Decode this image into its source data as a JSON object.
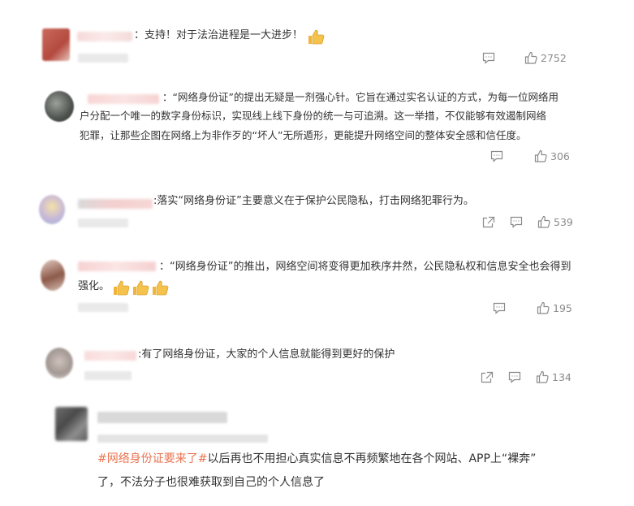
{
  "comments": [
    {
      "text": "：支持！对于法治进程是一大进步！",
      "likes": "2752"
    },
    {
      "text": "：“网络身份证”的提出无疑是一剂强心针。它旨在通过实名认证的方式，为每一位网络用户分配一个唯一的数字身份标识，实现线上线下身份的统一与可追溯。这一举措，不仅能够有效遏制网络犯罪，让那些企图在网络上为非作歹的“坏人”无所遁形，更能提升网络空间的整体安全感和信任度。",
      "line1": "：“网络身份证”的提出无疑是一剂强心针。它旨在通过实名认证的方式，为每一位网络用",
      "line2": "户分配一个唯一的数字身份标识，实现线上线下身份的统一与可追溯。这一举措，不仅能够有效遏制网络",
      "line3": "犯罪，让那些企图在网络上为非作歹的“坏人”无所遁形，更能提升网络空间的整体安全感和信任度。",
      "likes": "306"
    },
    {
      "text": ":落实“网络身份证”主要意义在于保护公民隐私，打击网络犯罪行为。",
      "likes": "539"
    },
    {
      "line1": "：“网络身份证”的推出，网络空间将变得更加秩序井然，公民隐私权和信息安全也会得到",
      "line2": "强化。",
      "likes": "195"
    },
    {
      "text": ":有了网络身份证，大家的个人信息就能得到更好的保护",
      "likes": "134"
    },
    {
      "topic": "#网络身份证要来了#",
      "line1_rest": "以后再也不用担心真实信息不再频繁地在各个网站、APP上“裸奔”",
      "line2": "了，不法分子也很难获取到自己的个人信息了"
    }
  ],
  "icons": {
    "comment": "comment-icon",
    "like": "like-icon",
    "share": "share-icon",
    "thumbs_up_emoji": "thumbs-up-emoji"
  },
  "colors": {
    "text": "#333333",
    "meta": "#8a8a8a",
    "topic": "#eb7350",
    "emoji": "#f5c24b"
  }
}
